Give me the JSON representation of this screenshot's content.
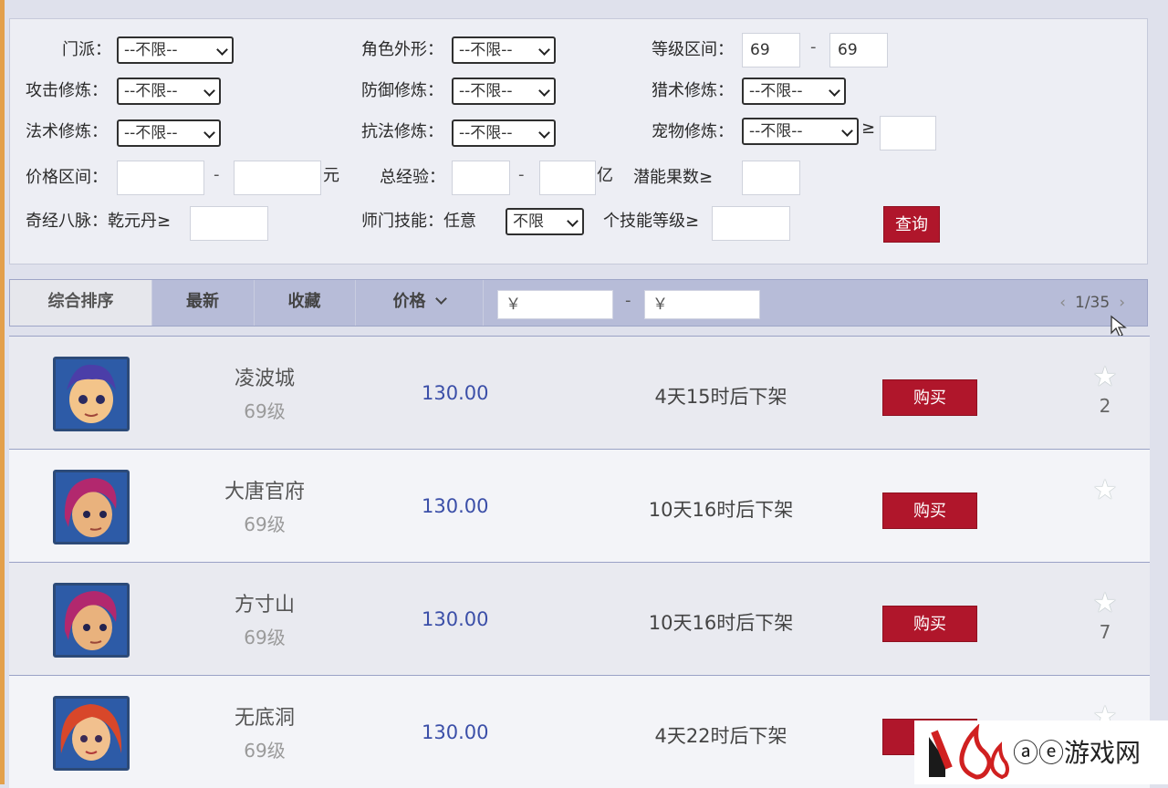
{
  "filters": {
    "menpai_label": "门派：",
    "menpai_value": "--不限--",
    "appearance_label": "角色外形：",
    "appearance_value": "--不限--",
    "level_label": "等级区间：",
    "level_min": "69",
    "level_max": "69",
    "level_dash": "-",
    "attack_label": "攻击修炼：",
    "attack_value": "--不限--",
    "defense_label": "防御修炼：",
    "defense_value": "--不限--",
    "hunt_label": "猎术修炼：",
    "hunt_value": "--不限--",
    "magic_label": "法术修炼：",
    "magic_value": "--不限--",
    "resist_label": "抗法修炼：",
    "resist_value": "--不限--",
    "pet_label": "宠物修炼：",
    "pet_value": "--不限--",
    "pet_ge": "≥",
    "price_label": "价格区间：",
    "price_dash": "-",
    "price_unit": "元",
    "exp_label": "总经验：",
    "exp_dash": "-",
    "exp_unit": "亿",
    "potential_label": "潜能果数≥",
    "meridian_label": "奇经八脉：乾元丹≥",
    "school_skill_label": "师门技能：任意",
    "school_skill_value": "不限",
    "skill_level_label": "个技能等级≥",
    "query_label": "查询"
  },
  "sortbar": {
    "tabs": [
      "综合排序",
      "最新",
      "收藏",
      "价格"
    ],
    "price_from_placeholder": "￥",
    "price_to_placeholder": "￥",
    "range_dash": "-",
    "prev": "‹",
    "next": "›",
    "page": "1/35"
  },
  "listings": [
    {
      "school": "凌波城",
      "level": "69级",
      "price": "130.00",
      "time": "4天15时后下架",
      "buy": "购买",
      "favorites": "2"
    },
    {
      "school": "大唐官府",
      "level": "69级",
      "price": "130.00",
      "time": "10天16时后下架",
      "buy": "购买",
      "favorites": ""
    },
    {
      "school": "方寸山",
      "level": "69级",
      "price": "130.00",
      "time": "10天16时后下架",
      "buy": "购买",
      "favorites": "7"
    },
    {
      "school": "无底洞",
      "level": "69级",
      "price": "130.00",
      "time": "4天22时后下架",
      "buy": "购买",
      "favorites": ""
    }
  ],
  "watermark": {
    "text": "ⓐⓔ游戏网"
  },
  "colors": {
    "accent_red": "#b0162b",
    "price_blue": "#3b4fa8",
    "sort_bar": "#b7bcd8"
  }
}
